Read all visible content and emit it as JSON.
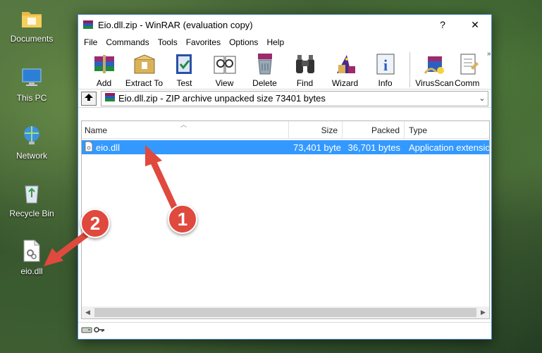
{
  "desktop": {
    "icons": [
      {
        "label": "Documents"
      },
      {
        "label": "This PC"
      },
      {
        "label": "Network"
      },
      {
        "label": "Recycle Bin"
      },
      {
        "label": "eio.dll"
      }
    ]
  },
  "window": {
    "title": "Eio.dll.zip - WinRAR (evaluation copy)",
    "help_button": "?",
    "close_button": "✕",
    "minimize_button": "—"
  },
  "menu": {
    "items": [
      "File",
      "Commands",
      "Tools",
      "Favorites",
      "Options",
      "Help"
    ]
  },
  "toolbar": {
    "buttons": [
      {
        "label": "Add",
        "icon": "add-archive-icon"
      },
      {
        "label": "Extract To",
        "icon": "extract-icon"
      },
      {
        "label": "Test",
        "icon": "test-icon"
      },
      {
        "label": "View",
        "icon": "view-icon"
      },
      {
        "label": "Delete",
        "icon": "delete-icon"
      },
      {
        "label": "Find",
        "icon": "binoculars-icon"
      },
      {
        "label": "Wizard",
        "icon": "wizard-icon"
      },
      {
        "label": "Info",
        "icon": "info-icon"
      },
      {
        "label": "VirusScan",
        "icon": "virusscan-icon"
      },
      {
        "label": "Comm",
        "icon": "comment-icon"
      }
    ],
    "more": "»"
  },
  "address": {
    "text": "Eio.dll.zip - ZIP archive unpacked size 73401 bytes"
  },
  "file_list": {
    "columns": [
      "Name",
      "Size",
      "Packed",
      "Type"
    ],
    "rows": [
      {
        "name": "eio.dll",
        "size": "73,401 byte",
        "packed": "36,701 bytes",
        "type": "Application extensio"
      }
    ]
  },
  "annotations": {
    "badge_1": "1",
    "badge_2": "2",
    "color": "#e0493e"
  }
}
